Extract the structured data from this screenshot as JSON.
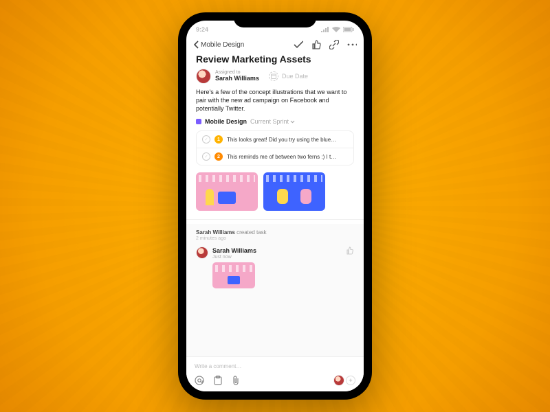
{
  "statusbar": {
    "time": "9:24"
  },
  "nav": {
    "back_label": "Mobile Design"
  },
  "task": {
    "title": "Review Marketing Assets",
    "assigned_label": "Assigned to",
    "assignee": "Sarah Williams",
    "due_label": "Due Date",
    "description": "Here's a few of the concept illustrations that we want to pair with the new ad campaign on Facebook and potentially Twitter.",
    "project": "Mobile Design",
    "sprint": "Current Sprint"
  },
  "subtasks": [
    {
      "num": "1",
      "text": "This looks great! Did you try using the blue…"
    },
    {
      "num": "2",
      "text": "This reminds me of between two ferns :) I t…"
    }
  ],
  "activity": {
    "created_who": "Sarah Williams",
    "created_action": "created task",
    "created_time": "2 minutes ago",
    "comment_who": "Sarah Williams",
    "comment_time": "Just now"
  },
  "composer": {
    "placeholder": "Write a comment…"
  }
}
